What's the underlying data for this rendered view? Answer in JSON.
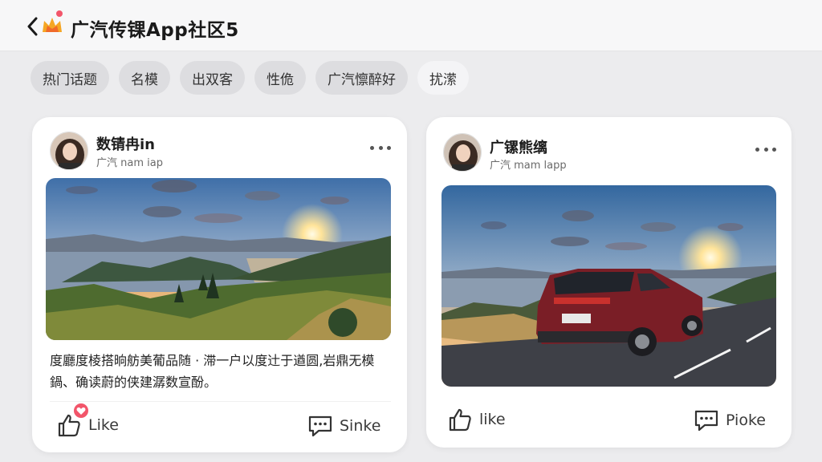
{
  "header": {
    "title": "广汽传锞App社区5",
    "back_icon": "chevron-left-icon",
    "logo_icon": "crown-logo-icon"
  },
  "tabs": [
    {
      "label": "热门话题",
      "style": "filled"
    },
    {
      "label": "名模",
      "style": "filled"
    },
    {
      "label": "出双客",
      "style": "filled"
    },
    {
      "label": "性佹",
      "style": "filled"
    },
    {
      "label": "广汽懔醉好",
      "style": "filled"
    },
    {
      "label": "扰潆",
      "style": "light"
    }
  ],
  "posts": [
    {
      "author": "数锖冉in",
      "subtitle": "广汽 nam iap",
      "image": "mountain-lake-sunset-photo",
      "text": "度廳度棱搭晌舫美葡品随 · 滞一户以度辻于遒圆,岩鼎无模鍋、确读蔚的侠建潺数宣酚。",
      "like_label": "Like",
      "share_label": "Sinke"
    },
    {
      "author": "广镙熊缡",
      "subtitle": "广汽 mam lapp",
      "image": "red-suv-coastal-road-photo",
      "like_label": "like",
      "share_label": "Pioke"
    }
  ],
  "colors": {
    "background": "#ececee",
    "card": "#ffffff",
    "badge": "#f2556a",
    "tab_fill": "#dddde0"
  }
}
